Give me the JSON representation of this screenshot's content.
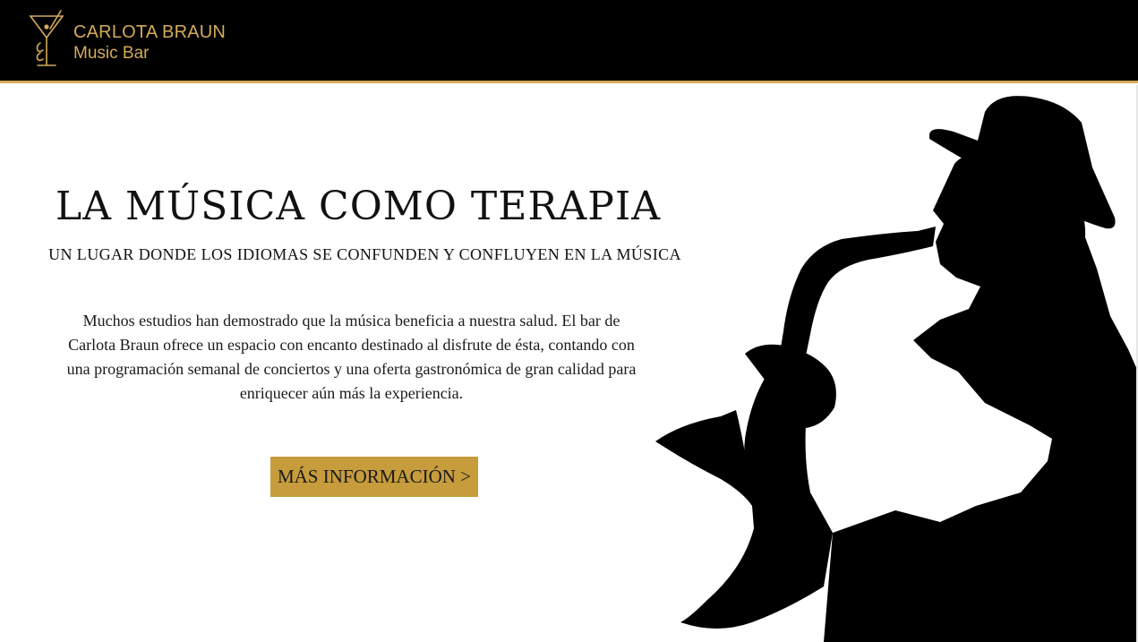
{
  "header": {
    "brand_name": "CARLOTA BRAUN",
    "brand_subtitle": "Music Bar",
    "logo_icon": "cocktail-glass-icon",
    "background_color": "#000000",
    "accent_color": "#d4ab5a"
  },
  "hero": {
    "title": "LA MÚSICA COMO TERAPIA",
    "subtitle": "UN LUGAR DONDE LOS IDIOMAS SE CONFUNDEN Y CONFLUYEN EN LA MÚSICA",
    "body": "Muchos estudios han demostrado que la música beneficia a nuestra salud. El bar de Carlota Braun ofrece un espacio con encanto destinado al disfrute de ésta, contando con una programación semanal de conciertos y una oferta gastronómica de gran calidad para enriquecer aún más la experiencia.",
    "cta_label": "MÁS INFORMACIÓN >",
    "cta_color": "#c69c3c",
    "image_icon": "saxophone-player-silhouette-icon"
  }
}
